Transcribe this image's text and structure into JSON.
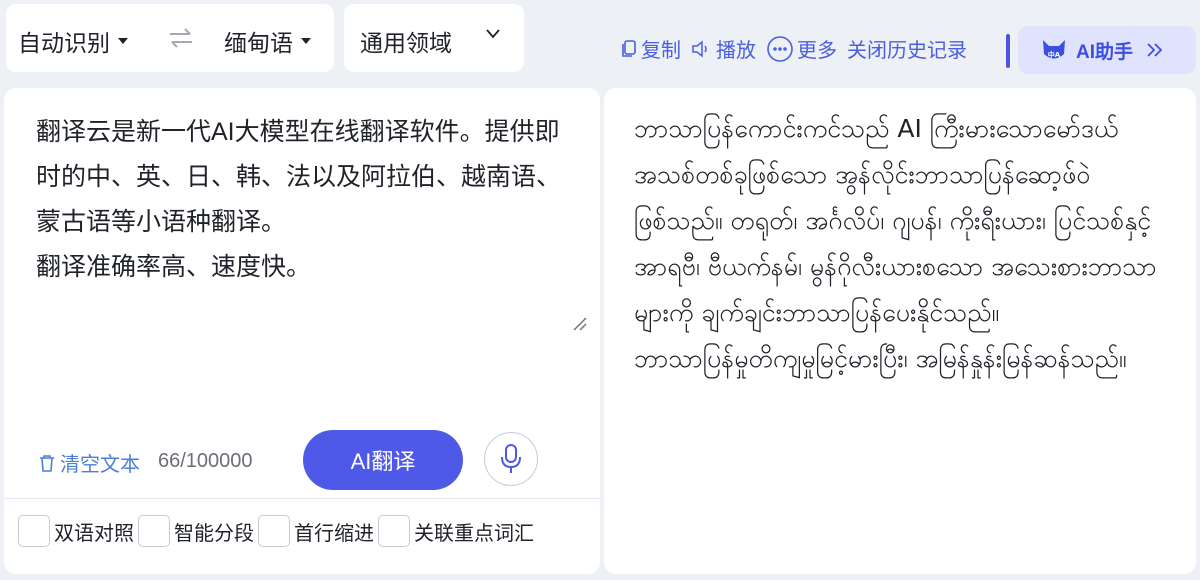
{
  "toolbar": {
    "source_language": "自动识别",
    "target_language": "缅甸语",
    "domain": "通用领域",
    "copy_label": "复制",
    "play_label": "播放",
    "more_label": "更多",
    "history_label": "关闭历史记录",
    "ai_helper_label": "AI助手"
  },
  "source": {
    "text": "翻译云是新一代AI大模型在线翻译软件。提供即时的中、英、日、韩、法以及阿拉伯、越南语、蒙古语等小语种翻译。\n翻译准确率高、速度快。",
    "clear_label": "清空文本",
    "char_count": "66/100000",
    "translate_button": "AI翻译"
  },
  "options": [
    "双语对照",
    "智能分段",
    "首行缩进",
    "关联重点词汇"
  ],
  "target": {
    "text": "ဘာသာပြန်ကောင်းကင်သည် AI ကြီးမားသောမော်ဒယ်အသစ်တစ်ခုဖြစ်သော အွန်လိုင်းဘာသာပြန်ဆော့ဖ်ဝဲဖြစ်သည်။ တရုတ်၊ အင်္ဂလိပ်၊ ဂျပန်၊ ကိုးရီးယား၊ ပြင်သစ်နှင့် အာရဗီ၊ ဗီယက်နမ်၊ မွန်ဂိုလီးယားစသော အသေးစားဘာသာများကို ချက်ချင်းဘာသာပြန်ပေးနိုင်သည်။\nဘာသာပြန်မှုတိကျမှုမြင့်မားပြီး၊ အမြန်နှုန်းမြန်ဆန်သည်။"
  },
  "colors": {
    "accent": "#4f59e8",
    "link": "#4a5fe0",
    "background": "#edf0f5"
  }
}
